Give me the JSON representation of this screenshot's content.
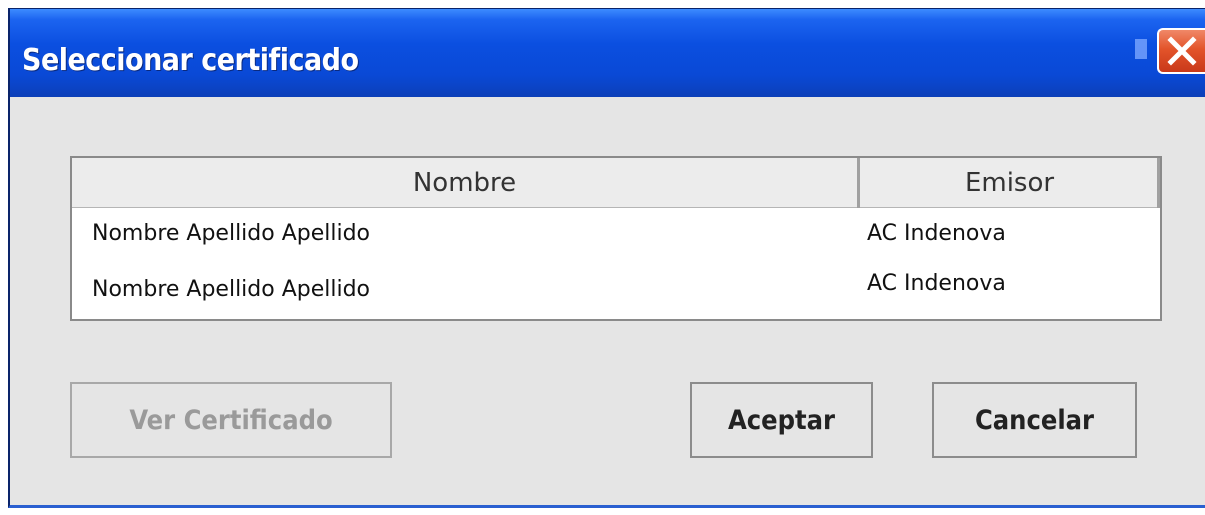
{
  "dialog": {
    "title": "Seleccionar certificado",
    "close_icon": "close-icon",
    "colors": {
      "titlebar": "#0a49d6",
      "close_button": "#e3542a",
      "body": "#e5e5e5"
    }
  },
  "table": {
    "columns": [
      "Nombre",
      "Emisor"
    ],
    "rows": [
      {
        "nombre": "Nombre Apellido Apellido",
        "emisor": "AC Indenova"
      },
      {
        "nombre": "Nombre Apellido Apellido",
        "emisor": "AC Indenova"
      }
    ]
  },
  "buttons": {
    "view_certificate": "Ver Certificado",
    "accept": "Aceptar",
    "cancel": "Cancelar"
  }
}
